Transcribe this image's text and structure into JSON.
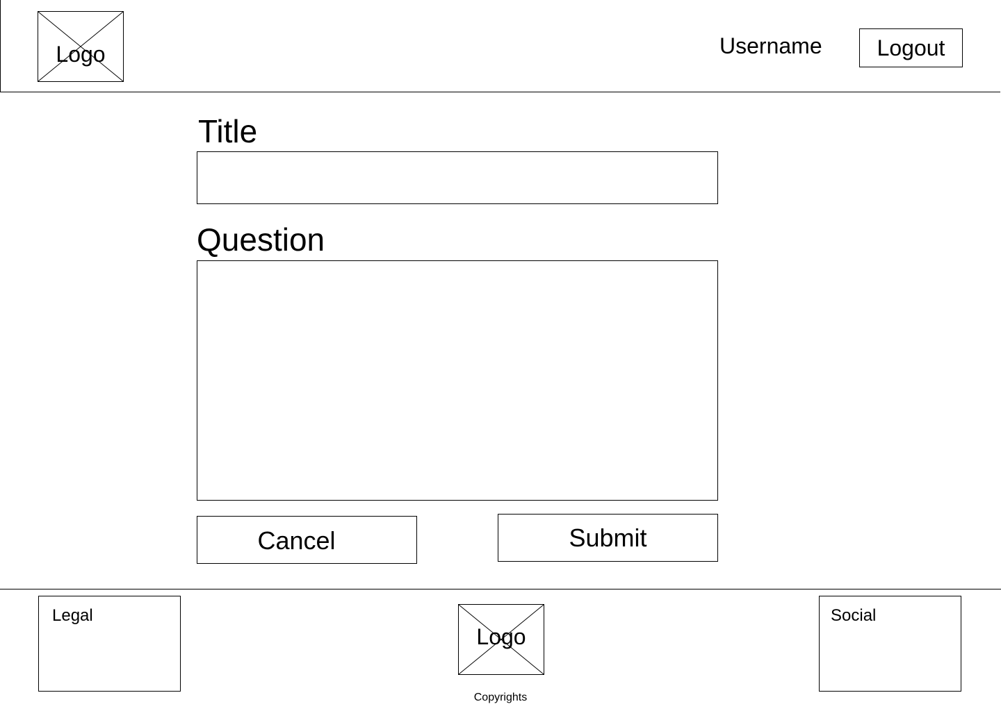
{
  "header": {
    "logo_label": "Logo",
    "username": "Username",
    "logout_label": "Logout"
  },
  "form": {
    "title_label": "Title",
    "title_value": "",
    "question_label": "Question",
    "question_value": "",
    "cancel_label": "Cancel",
    "submit_label": "Submit"
  },
  "footer": {
    "legal_label": "Legal",
    "logo_label": "Logo",
    "social_label": "Social",
    "copyright": "Copyrights"
  }
}
